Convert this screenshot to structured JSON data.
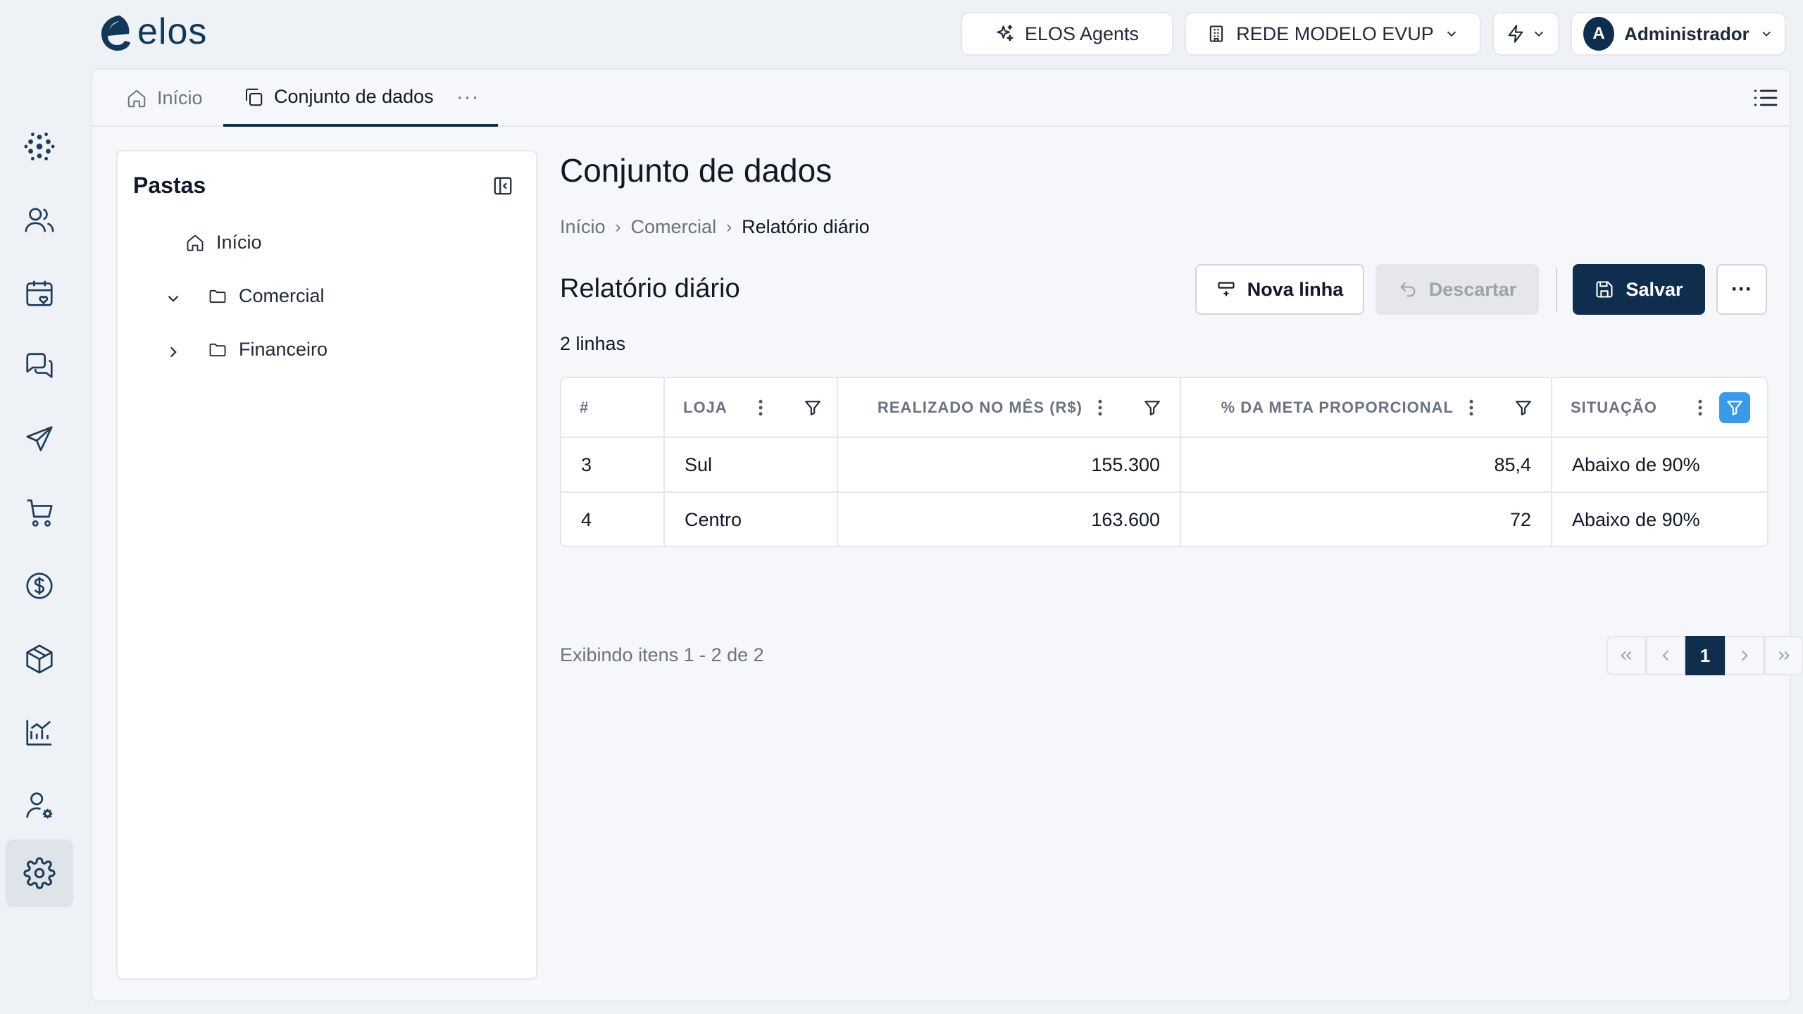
{
  "app": {
    "logo_text": "elos"
  },
  "topbar": {
    "agents_label": "ELOS Agents",
    "org_label": "REDE MODELO EVUP",
    "user_initial": "A",
    "user_name": "Administrador"
  },
  "rail": {
    "items": [
      "network-icon",
      "users-icon",
      "calendar-heart-icon",
      "chat-icon",
      "send-icon",
      "cart-icon",
      "dollar-icon",
      "box-icon",
      "chart-icon",
      "user-settings-icon",
      "gear-icon"
    ],
    "active": "gear-icon"
  },
  "tabs": {
    "home_label": "Início",
    "dataset_label": "Conjunto de dados",
    "more_label": "···"
  },
  "folders": {
    "title": "Pastas",
    "items": [
      {
        "label": "Início"
      },
      {
        "label": "Comercial"
      },
      {
        "label": "Financeiro"
      }
    ]
  },
  "page": {
    "title": "Conjunto de dados",
    "breadcrumb": [
      "Início",
      "Comercial",
      "Relatório diário"
    ],
    "section_title": "Relatório diário",
    "row_count": "2 linhas"
  },
  "toolbar": {
    "new_row_label": "Nova linha",
    "discard_label": "Descartar",
    "save_label": "Salvar",
    "more_label": "···"
  },
  "table": {
    "columns": [
      "#",
      "LOJA",
      "REALIZADO NO MÊS (R$)",
      "% DA META PROPORCIONAL",
      "SITUAÇÃO"
    ],
    "rows": [
      [
        "3",
        "Sul",
        "155.300",
        "85,4",
        "Abaixo de 90%"
      ],
      [
        "4",
        "Centro",
        "163.600",
        "72",
        "Abaixo de 90%"
      ]
    ]
  },
  "pager": {
    "info": "Exibindo itens 1 - 2 de 2",
    "current_page": "1"
  },
  "colors": {
    "brand": "#0f2e4e",
    "filter_active": "#3b9ae8"
  }
}
